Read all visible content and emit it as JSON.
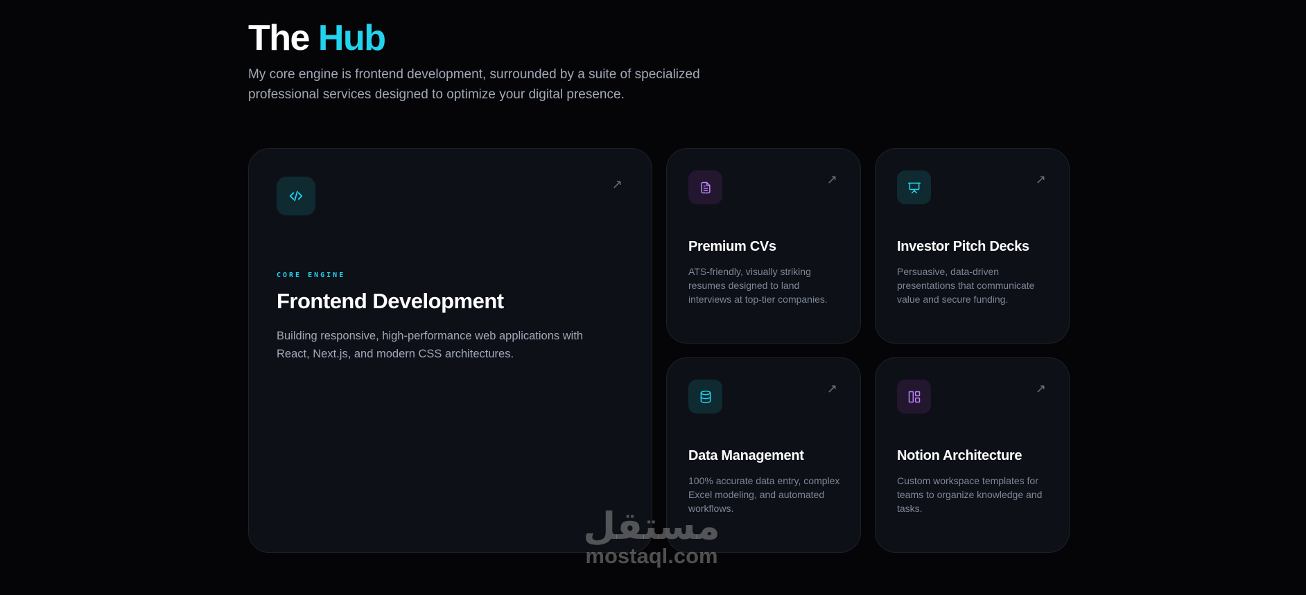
{
  "hero": {
    "title_main": "The",
    "title_accent": "Hub",
    "description": "My core engine is frontend development, surrounded by a suite of specialized professional services designed to optimize your digital presence.",
    "accent_color": "#22d3ee"
  },
  "featured": {
    "icon": "code-icon",
    "kicker": "CORE ENGINE",
    "title": "Frontend Development",
    "description": "Building responsive, high-performance web applications with React, Next.js, and modern CSS architectures.",
    "arrow": "↗"
  },
  "services": [
    {
      "icon": "document-icon",
      "title": "Premium CVs",
      "description": "ATS-friendly, visually striking resumes designed to land interviews at top-tier companies.",
      "arrow": "↗",
      "color": "#c084fc"
    },
    {
      "icon": "presentation-icon",
      "title": "Investor Pitch Decks",
      "description": "Persuasive, data-driven presentations that communicate value and secure funding.",
      "arrow": "↗",
      "color": "#22d3ee"
    },
    {
      "icon": "database-icon",
      "title": "Data Management",
      "description": "100% accurate data entry, complex Excel modeling, and automated workflows.",
      "arrow": "↗",
      "color": "#22d3ee"
    },
    {
      "icon": "layout-icon",
      "title": "Notion Architecture",
      "description": "Custom workspace templates for teams to organize knowledge and tasks.",
      "arrow": "↗",
      "color": "#c084fc"
    }
  ],
  "watermark": {
    "arabic": "مستقل",
    "latin": "mostaql.com"
  }
}
